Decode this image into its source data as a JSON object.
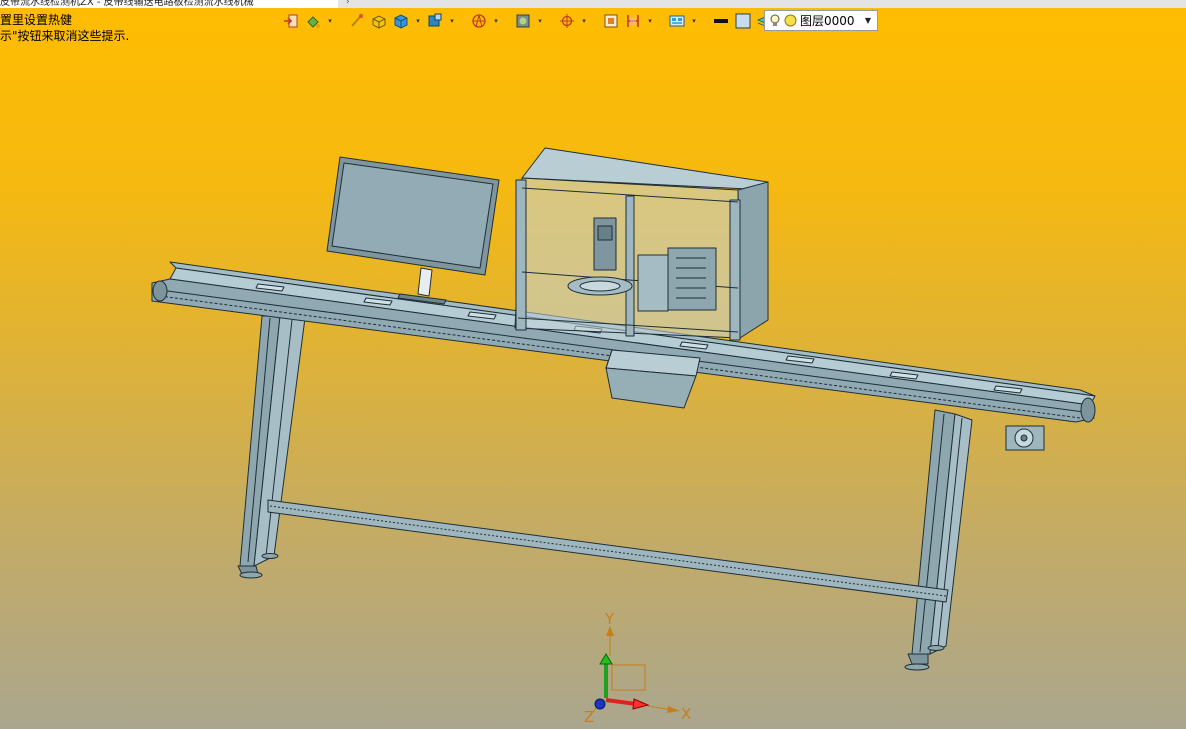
{
  "tabs": {
    "active_title": "皮带流水线检测机ZX - 皮带线输送电路板检测流水线机械"
  },
  "hints": {
    "line1": "置里设置热健",
    "line2": "示\"按钮来取消这些提示."
  },
  "layer_selector": {
    "value": "图层0000"
  },
  "axes": {
    "x": "X",
    "y": "Y",
    "z": "Z"
  },
  "colors": {
    "background_top": "#ffbc00",
    "background_bottom": "#aaa68e",
    "model": "#8fa8b2",
    "edge": "#1e2f38"
  }
}
